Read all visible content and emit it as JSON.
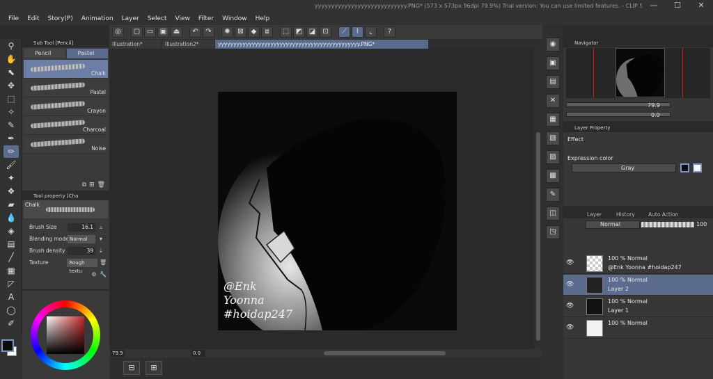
{
  "app": {
    "title": "yyyyyyyyyyyyyyyyyyyyyyyyyyyy.PNG* (573 x 573px 96dpi 79.9%)  Trial version: You can use limited features. - CLIP STUDIO PAINT EX",
    "menu": [
      "File",
      "Edit",
      "Story(P)",
      "Animation",
      "Layer",
      "Select",
      "View",
      "Filter",
      "Window",
      "Help"
    ],
    "window_controls": [
      "—",
      "☐",
      "✕"
    ]
  },
  "tabs": [
    {
      "label": "Illustration*",
      "active": false
    },
    {
      "label": "Illustration2*",
      "active": false
    },
    {
      "label": "yyyyyyyyyyyyyyyyyyyyyyyyyyyyyyyyyyyyyyyyyyyyyy.PNG*",
      "active": true
    }
  ],
  "subtool": {
    "header": "Sub Tool [Pencil]",
    "tabs": [
      {
        "label": "Pencil"
      },
      {
        "label": "Pastel"
      }
    ],
    "brushes": [
      {
        "name": "Chalk",
        "selected": true
      },
      {
        "name": "Pastel",
        "selected": false
      },
      {
        "name": "Crayon",
        "selected": false
      },
      {
        "name": "Charcoal",
        "selected": false
      },
      {
        "name": "Noise",
        "selected": false
      }
    ]
  },
  "toolprop": {
    "header": "Tool property [Cha",
    "brush_name": "Chalk",
    "brush_size_label": "Brush Size",
    "brush_size": "16.1",
    "blending_mode_label": "Blending mode",
    "blending_mode": "Normal",
    "brush_density_label": "Brush density",
    "brush_density": "39",
    "texture_label": "Texture",
    "texture": "Rough textu"
  },
  "artwork": {
    "signature_lines": [
      "@Enk",
      "Yoonna",
      "#hoidap247"
    ]
  },
  "status": {
    "zoom": "79.9",
    "rotation": "0.0"
  },
  "navigator": {
    "header": "Navigator",
    "zoom": "79.9",
    "rotation": "0.0"
  },
  "layer_property": {
    "header": "Layer Property",
    "effect_label": "Effect",
    "expression_color_label": "Expression color",
    "expression_color": "Gray"
  },
  "layer_panel": {
    "tabs": [
      "Layer",
      "History",
      "Auto Action"
    ],
    "blend_mode": "Normal",
    "opacity": "100",
    "layers": [
      {
        "mode": "100 % Normal",
        "name": "@Enk Yoonna #hoidap247",
        "selected": false
      },
      {
        "mode": "100 % Normal",
        "name": "Layer 2",
        "selected": true
      },
      {
        "mode": "100 % Normal",
        "name": "Layer 1",
        "selected": false
      },
      {
        "mode": "100 % Normal",
        "name": "",
        "selected": false
      }
    ]
  },
  "colors": {
    "accent": "#5a6b8e",
    "foreground": "#0b0b0b",
    "background": "#ffffff"
  }
}
